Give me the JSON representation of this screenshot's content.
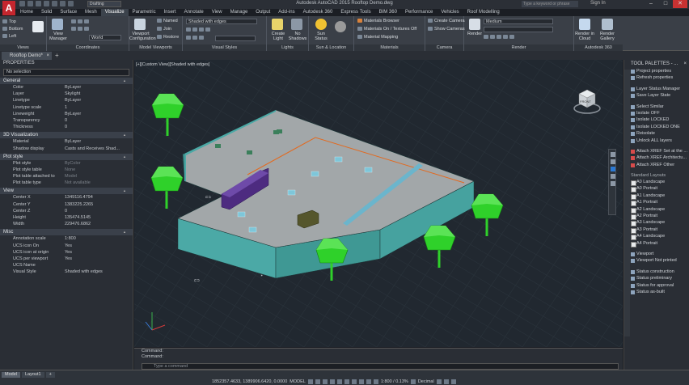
{
  "app": {
    "logo": "A",
    "workspace": "Drafting",
    "title": "Autodesk AutoCAD 2015   Rooftop Demo.dwg",
    "search_placeholder": "Type a keyword or phrase",
    "signin": "Sign In"
  },
  "ribbon_tabs": [
    "Home",
    "Solid",
    "Surface",
    "Mesh",
    "Visualize",
    "Parametric",
    "Insert",
    "Annotate",
    "View",
    "Manage",
    "Output",
    "Add-ins",
    "Autodesk 360",
    "Express Tools",
    "BIM 360",
    "Performance",
    "Vehicles",
    "Roof Modelling"
  ],
  "active_tab": "Visualize",
  "ribbon": {
    "views": {
      "title": "Views",
      "items": [
        "Top",
        "Bottom",
        "Left"
      ]
    },
    "coordinates": {
      "title": "Coordinates",
      "view_manager": "View Manager",
      "world": "World"
    },
    "model_viewports": {
      "title": "Model Viewports",
      "viewport_config": "Viewport Configuration",
      "named": "Named",
      "join": "Join",
      "restore": "Restore"
    },
    "visual_styles": {
      "title": "Visual Styles",
      "value": "Shaded with edges"
    },
    "lights": {
      "title": "Lights",
      "create_light": "Create Light",
      "no_shadows": "No Shadows"
    },
    "sun_location": {
      "title": "Sun & Location",
      "sun_status": "Sun Status"
    },
    "materials": {
      "title": "Materials",
      "browser": "Materials Browser",
      "off": "Materials On / Textures Off",
      "mapping": "Material Mapping"
    },
    "camera": {
      "title": "Camera",
      "create": "Create Camera",
      "show": "Show Cameras"
    },
    "render": {
      "title": "Render",
      "render_btn": "Render",
      "preset": "Medium"
    },
    "a360": {
      "title": "Autodesk 360",
      "render_cloud": "Render in Cloud",
      "render_gallery": "Render Gallery"
    }
  },
  "file_tab": {
    "name": "Rooftop Demo*"
  },
  "properties": {
    "title": "PROPERTIES",
    "selection": "No selection",
    "sections": [
      {
        "name": "General",
        "rows": [
          [
            "Color",
            "ByLayer"
          ],
          [
            "Layer",
            "Skylight"
          ],
          [
            "Linetype",
            "ByLayer"
          ],
          [
            "Linetype scale",
            "1"
          ],
          [
            "Lineweight",
            "ByLayer"
          ],
          [
            "Transparency",
            "0"
          ],
          [
            "Thickness",
            "0"
          ]
        ]
      },
      {
        "name": "3D Visualization",
        "rows": [
          [
            "Material",
            "ByLayer"
          ],
          [
            "Shadow display",
            "Casts and Receives Shad..."
          ]
        ]
      },
      {
        "name": "Plot style",
        "rows": [
          [
            "Plot style",
            "ByColor"
          ],
          [
            "Plot style table",
            "None"
          ],
          [
            "Plot table attached to",
            "Model"
          ],
          [
            "Plot table type",
            "Not available"
          ]
        ]
      },
      {
        "name": "View",
        "rows": [
          [
            "Center X",
            "1349116.4794"
          ],
          [
            "Center Y",
            "1383225.2265"
          ],
          [
            "Center Z",
            "0"
          ],
          [
            "Height",
            "135474.5145"
          ],
          [
            "Width",
            "229476.6862"
          ]
        ]
      },
      {
        "name": "Misc",
        "rows": [
          [
            "Annotation scale",
            "1:800"
          ],
          [
            "UCS icon On",
            "Yes"
          ],
          [
            "UCS icon at origin",
            "Yes"
          ],
          [
            "UCS per viewport",
            "Yes"
          ],
          [
            "UCS Name",
            ""
          ],
          [
            "Visual Style",
            "Shaded with edges"
          ]
        ]
      }
    ]
  },
  "viewport": {
    "label": "[+][Custom View][Shaded with edges]",
    "viewcube_face": "FRONT",
    "viewcube_compass": [
      "N",
      "S",
      "E",
      "W"
    ]
  },
  "tool_palettes": {
    "title": "TOOL PALETTES - ...",
    "side_tabs": [
      "General",
      "Layers",
      "Xref",
      "Layouts"
    ],
    "groups": [
      {
        "items": [
          "Project properties",
          "Refresh properties"
        ]
      },
      {
        "items": [
          "Layer Status Manager",
          "Save Layer State"
        ]
      },
      {
        "items": [
          "Select Similar",
          "Isolate OFF",
          "Isolate LOCKED",
          "Isolate LOCKED ONE",
          "Reisolate",
          "Unlock ALL layers"
        ]
      },
      {
        "items": [
          "Attach XREF Set at the ...",
          "Attach XREF Architectu...",
          "Attach XREF Other"
        ]
      }
    ],
    "layouts_header": "Standard Layouts",
    "layouts": [
      "A0 Landscape",
      "A0 Portrait",
      "A1 Landscape",
      "A1 Portrait",
      "A2 Landscape",
      "A2 Portrait",
      "A3 Landscape",
      "A3 Portrait",
      "A4 Landscape",
      "A4 Portrait"
    ],
    "extra": [
      "Viewport",
      "Viewport Not printed"
    ],
    "status_items": [
      "Status construction",
      "Status preliminary",
      "Status for approval",
      "Status as-built"
    ]
  },
  "command": {
    "line1": "Command:",
    "line2": "Command:",
    "placeholder": "Type a command"
  },
  "status_bar": {
    "layout_tabs": [
      "Model",
      "Layout1"
    ],
    "coords": "1852357.4633, 1389906.6420, 0.0000",
    "model": "MODEL",
    "scale": "1:800 / 0.13%",
    "units": "Decimal"
  },
  "colors": {
    "accent": "#2b79d3",
    "building_top": "#9da2a4",
    "building_side": "#4fb0ad",
    "tree": "#2fd12a",
    "parapet_line": "#e26a20",
    "hvac": "#4b2a7d"
  }
}
